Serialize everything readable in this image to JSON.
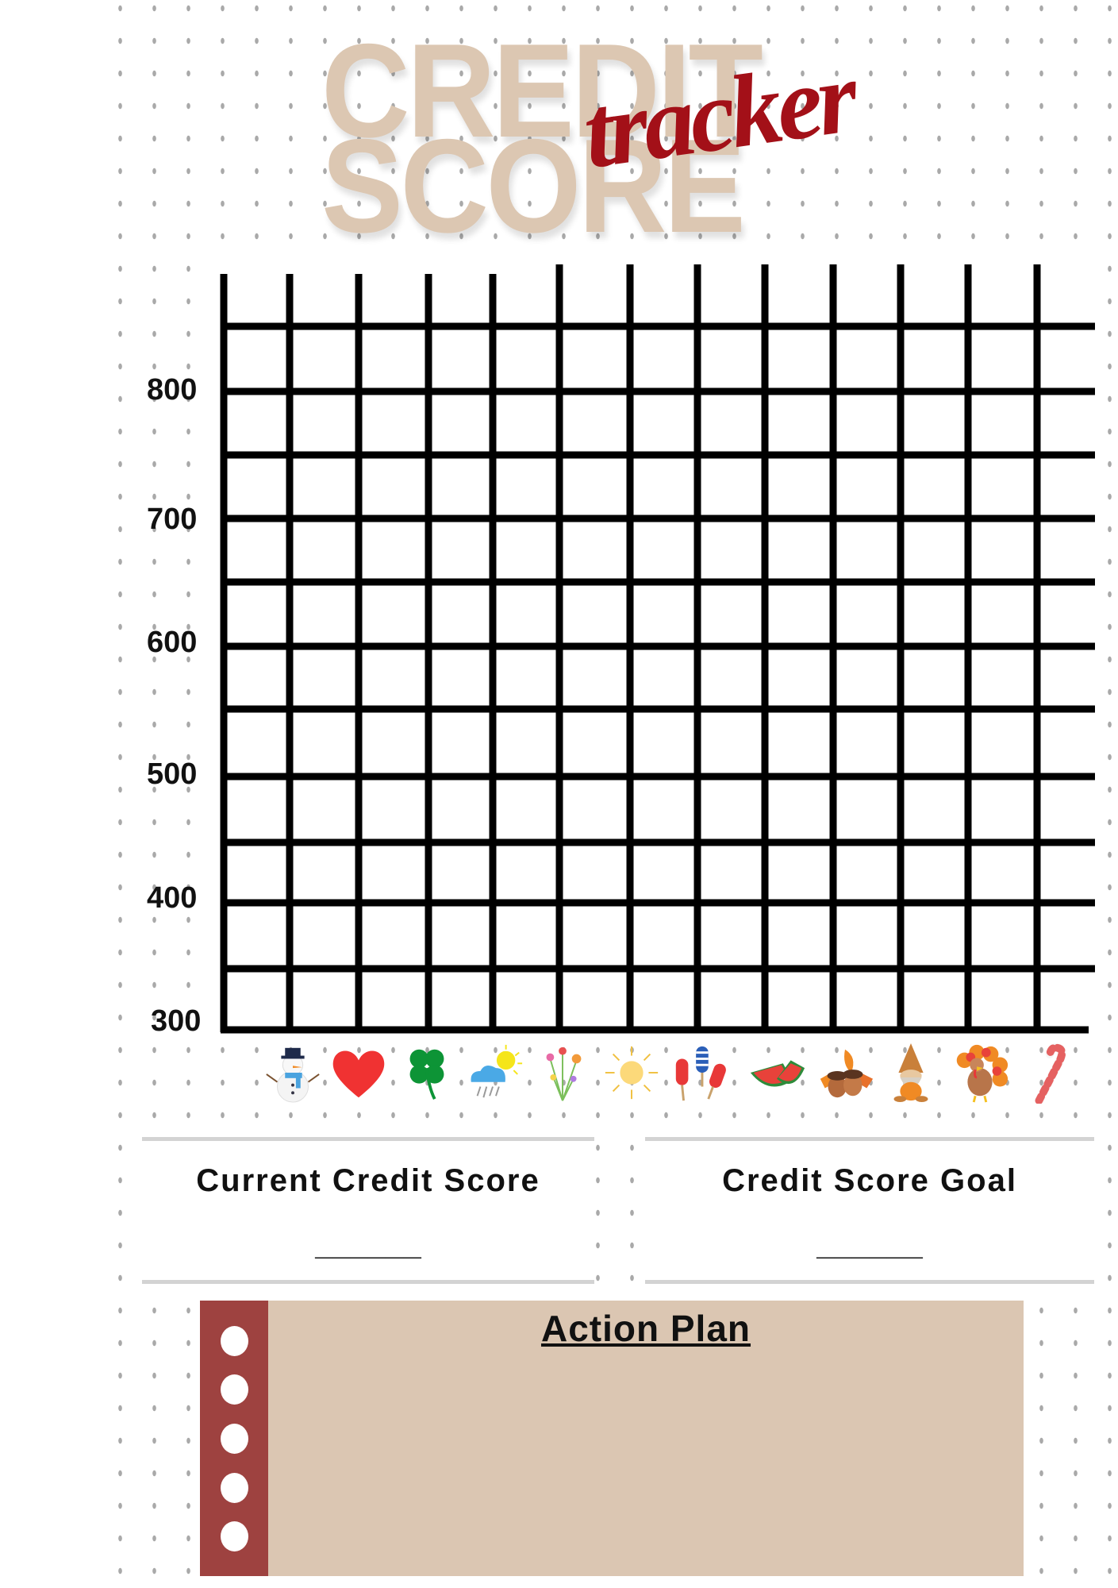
{
  "header": {
    "title_line1": "CREDIT",
    "title_line2": "SCORE",
    "script_word": "tracker"
  },
  "colors": {
    "title": "#dcc7b2",
    "script": "#a31018",
    "plan_bg": "#dbc6b2",
    "plan_bar": "#9e4240",
    "grid": "#000000",
    "dots": "#a9a9a9"
  },
  "chart_data": {
    "type": "line",
    "title": "",
    "xlabel": "",
    "ylabel": "",
    "y_ticks": [
      "800",
      "700",
      "600",
      "500",
      "400",
      "300"
    ],
    "ylim": [
      300,
      850
    ],
    "grid": true,
    "categories": [
      "snowman-icon",
      "heart-icon",
      "clover-icon",
      "sun-cloud-rain-icon",
      "flowers-icon",
      "sun-icon",
      "popsicles-icon",
      "watermelon-icon",
      "acorns-leaves-icon",
      "gnome-pumpkin-icon",
      "turkey-icon",
      "candy-cane-icon"
    ],
    "series": []
  },
  "boxes": {
    "current_label": "Current Credit Score",
    "current_value": "______",
    "goal_label": "Credit Score Goal",
    "goal_value": "______"
  },
  "action_plan": {
    "title": "Action Plan"
  }
}
